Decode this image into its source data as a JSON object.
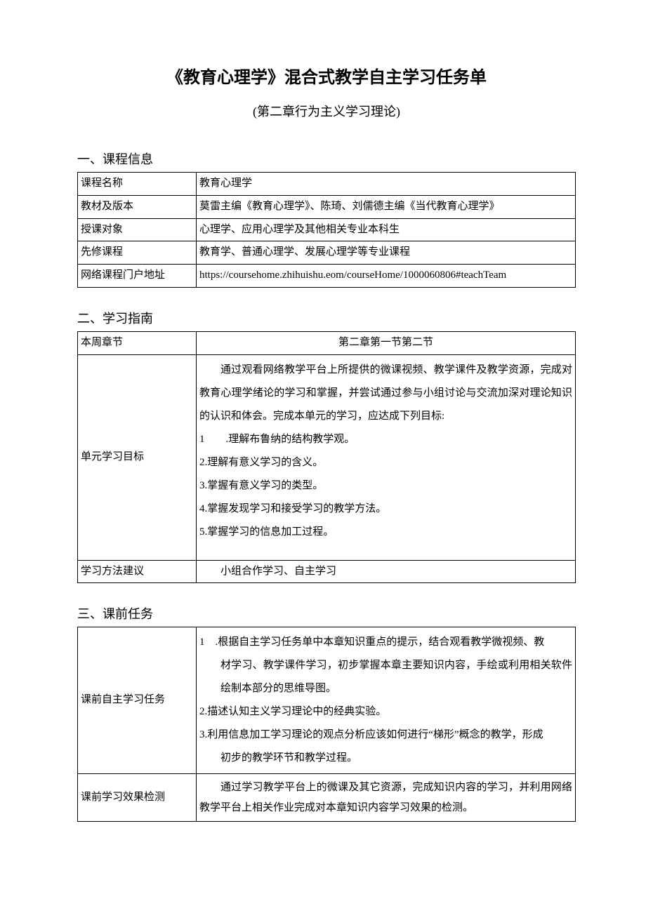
{
  "title": "《教育心理学》混合式教学自主学习任务单",
  "subtitle": "(第二章行为主义学习理论)",
  "section1": {
    "heading": "一、课程信息",
    "rows": {
      "r1": {
        "label": "课程名称",
        "value": "教育心理学"
      },
      "r2": {
        "label": "教材及版本",
        "value": "莫雷主编《教育心理学》、陈琦、刘儒德主编《当代教育心理学》"
      },
      "r3": {
        "label": "授课对象",
        "value": "心理学、应用心理学及其他相关专业本科生"
      },
      "r4": {
        "label": "先修课程",
        "value": "教育学、普通心理学、发展心理学等专业课程"
      },
      "r5": {
        "label": "网络课程门户地址",
        "value": "https://coursehome.zhihuishu.eom/courseHome/1000060806#teachTeam"
      }
    }
  },
  "section2": {
    "heading": "二、学习指南",
    "rows": {
      "r1": {
        "label": "本周章节",
        "value": "第二章第一节第二节"
      },
      "r2": {
        "label": "单元学习目标",
        "intro": "通过观看网络教学平台上所提供的微课视频、教学课件及教学资源，完成对教育心理学绪论的学习和掌握，并尝试通过参与小组讨论与交流加深对理论知识的认识和体会。完成本单元的学习，应达成下列目标:",
        "items": {
          "i1": "1  .理解布鲁纳的结构教学观。",
          "i2": "2.理解有意义学习的含义。",
          "i3": "3.掌握有意义学习的类型。",
          "i4": "4.掌握发现学习和接受学习的教学方法。",
          "i5": "5.掌握学习的信息加工过程。"
        }
      },
      "r3": {
        "label": "学习方法建议",
        "value": "小组合作学习、自主学习"
      }
    }
  },
  "section3": {
    "heading": "三、课前任务",
    "rows": {
      "r1": {
        "label": "课前自主学习任务",
        "items": {
          "i1a": "1 .根据自主学习任务单中本章知识重点的提示，结合观看教学微视频、教",
          "i1b": "材学习、教学课件学习，初步掌握本章主要知识内容，手绘或利用相关软件绘制本部分的思维导图。",
          "i2": "2.描述认知主义学习理论中的经典实验。",
          "i3a": "3.利用信息加工学习理论的观点分析应该如何进行“梯形”概念的教学，形成",
          "i3b": "初步的教学环节和教学过程。"
        }
      },
      "r2": {
        "label": "课前学习效果检测",
        "value": "通过学习教学平台上的微课及其它资源，完成知识内容的学习，并利用网络教学平台上相关作业完成对本章知识内容学习效果的检测。"
      }
    }
  }
}
